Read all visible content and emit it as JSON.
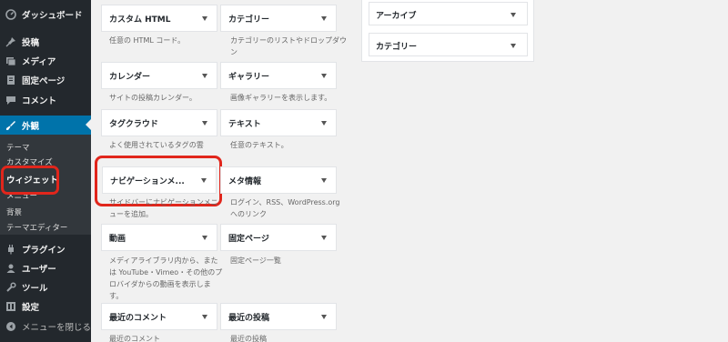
{
  "sidebar": {
    "menu": [
      {
        "label": "ダッシュボード",
        "icon": "dashboard-icon"
      },
      {
        "label": "投稿",
        "icon": "pin-icon"
      },
      {
        "label": "メディア",
        "icon": "media-icon"
      },
      {
        "label": "固定ページ",
        "icon": "page-icon"
      },
      {
        "label": "コメント",
        "icon": "comment-icon"
      },
      {
        "label": "外観",
        "icon": "brush-icon"
      },
      {
        "label": "プラグイン",
        "icon": "plugin-icon"
      },
      {
        "label": "ユーザー",
        "icon": "user-icon"
      },
      {
        "label": "ツール",
        "icon": "wrench-icon"
      },
      {
        "label": "設定",
        "icon": "settings-icon"
      },
      {
        "label": "メニューを閉じる",
        "icon": "collapse-icon"
      }
    ],
    "submenu": [
      "テーマ",
      "カスタマイズ",
      "ウィジェット",
      "メニュー",
      "背景",
      "テーマエディター"
    ]
  },
  "widgets": [
    {
      "title": "カスタム HTML",
      "desc": "任意の HTML コード。"
    },
    {
      "title": "カテゴリー",
      "desc": "カテゴリーのリストやドロップダウン"
    },
    {
      "title": "カレンダー",
      "desc": "サイトの投稿カレンダー。"
    },
    {
      "title": "ギャラリー",
      "desc": "画像ギャラリーを表示します。"
    },
    {
      "title": "タグクラウド",
      "desc": "よく使用されているタグの雲"
    },
    {
      "title": "テキスト",
      "desc": "任意のテキスト。"
    },
    {
      "title": "ナビゲーションメ...",
      "desc": "サイドバーにナビゲーションメニューを追加。"
    },
    {
      "title": "メタ情報",
      "desc": "ログイン、RSS、WordPress.org へのリンク"
    },
    {
      "title": "動画",
      "desc": "メディアライブラリ内から、または YouTube・Vimeo・その他のプロバイダからの動画を表示します。"
    },
    {
      "title": "固定ページ",
      "desc": "固定ページ一覧"
    },
    {
      "title": "最近のコメント",
      "desc": "最近のコメント"
    },
    {
      "title": "最近の投稿",
      "desc": "最近の投稿"
    }
  ],
  "sidebar_area": {
    "widgets": [
      "アーカイブ",
      "カテゴリー"
    ]
  }
}
